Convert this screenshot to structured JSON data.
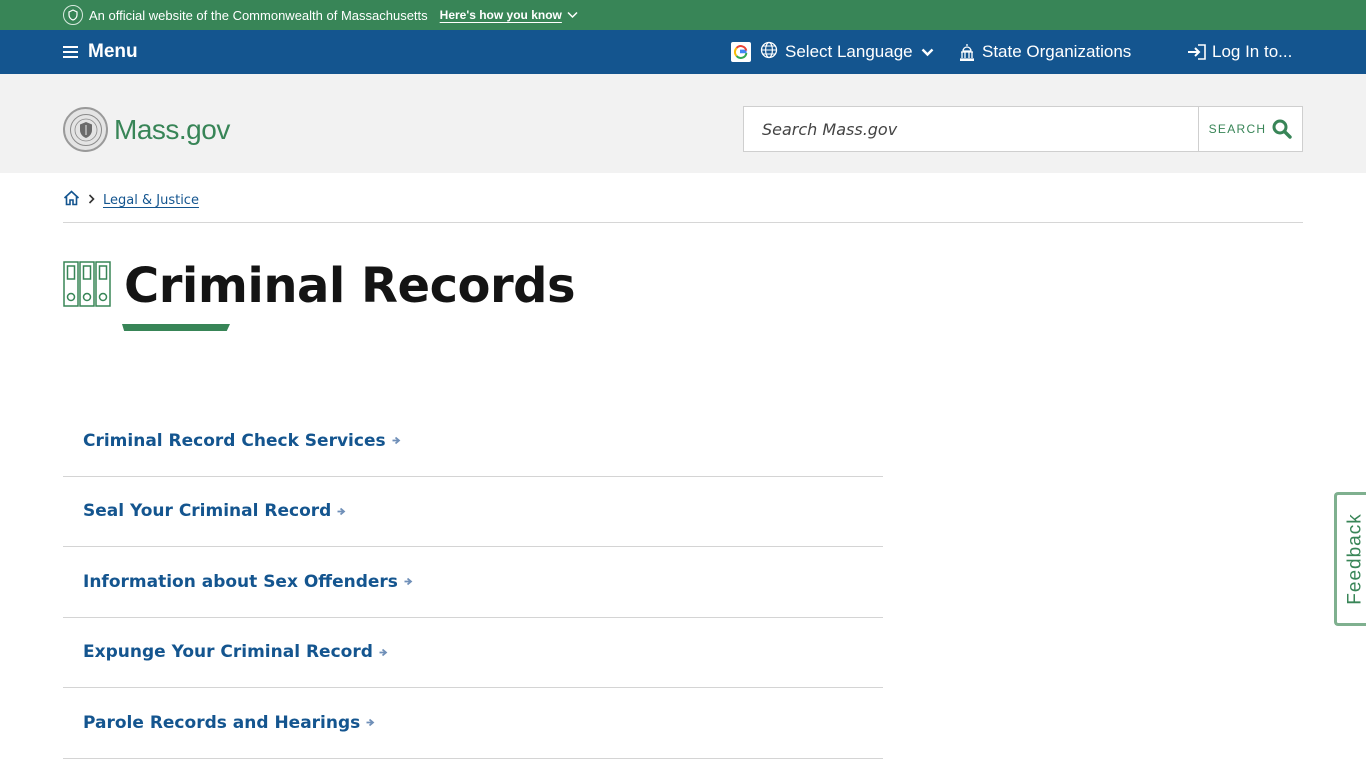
{
  "official_banner": {
    "text": "An official website of the Commonwealth of Massachusetts",
    "how_you_know": "Here's how you know"
  },
  "utility_nav": {
    "menu_label": "Menu",
    "language_label": "Select Language",
    "state_orgs_label": "State Organizations",
    "login_label": "Log In to..."
  },
  "header": {
    "logo_text": "Mass.gov",
    "search_placeholder": "Search Mass.gov",
    "search_button": "SEARCH"
  },
  "breadcrumb": {
    "items": [
      {
        "label": "Legal & Justice"
      }
    ]
  },
  "page": {
    "title": "Criminal Records"
  },
  "links": [
    {
      "label": "Criminal Record Check Services"
    },
    {
      "label": "Seal Your Criminal Record"
    },
    {
      "label": "Information about Sex Offenders"
    },
    {
      "label": "Expunge Your Criminal Record"
    },
    {
      "label": "Parole Records and Hearings"
    }
  ],
  "feedback_label": "Feedback",
  "colors": {
    "green": "#388557",
    "blue": "#14558f",
    "header_bg": "#f2f2f2"
  },
  "icons": [
    "seal-icon",
    "chevron-down-icon",
    "hamburger-icon",
    "google-icon",
    "globe-icon",
    "capitol-icon",
    "login-icon",
    "search-icon",
    "home-icon",
    "chevron-right-icon",
    "binders-icon",
    "arrow-right-icon"
  ]
}
